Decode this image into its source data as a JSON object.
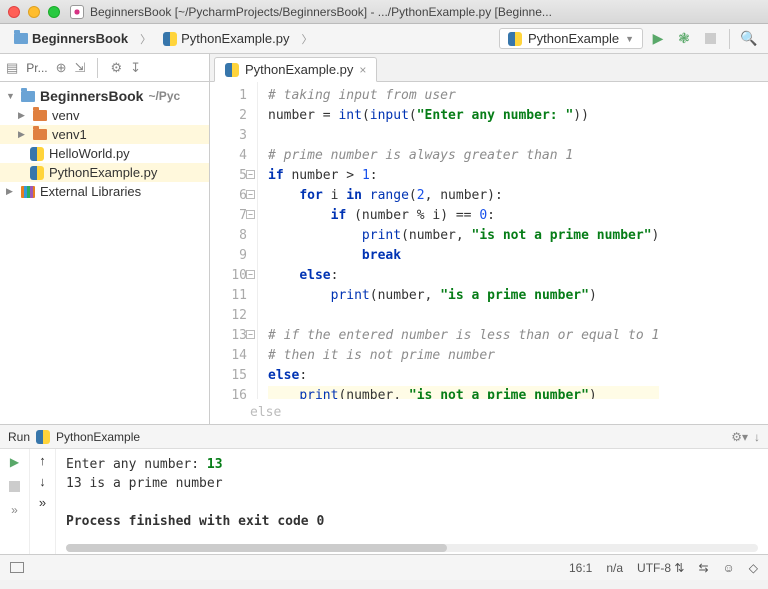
{
  "window_title": "BeginnersBook [~/PycharmProjects/BeginnersBook] - .../PythonExample.py [Beginne...",
  "breadcrumbs": {
    "project": "BeginnersBook",
    "file": "PythonExample.py"
  },
  "run_config": "PythonExample",
  "project_panel": {
    "label": "Pr...",
    "root": "BeginnersBook",
    "root_suffix": "~/Pyc",
    "items": {
      "venv": "venv",
      "venv1": "venv1",
      "hello": "HelloWorld.py",
      "example": "PythonExample.py"
    },
    "external": "External Libraries"
  },
  "tab_name": "PythonExample.py",
  "code_lines": [
    {
      "n": 1,
      "html": "<span class='c-com'># taking input from user</span>"
    },
    {
      "n": 2,
      "html": "number = <span class='c-bi'>int</span>(<span class='c-bi'>input</span>(<span class='c-str'>\"Enter any number: \"</span>))"
    },
    {
      "n": 3,
      "html": ""
    },
    {
      "n": 4,
      "html": "<span class='c-com'># prime number is always greater than 1</span>"
    },
    {
      "n": 5,
      "html": "<span class='c-kw'>if</span> number &gt; <span class='c-num'>1</span>:",
      "fold": true
    },
    {
      "n": 6,
      "html": "    <span class='c-kw'>for</span> i <span class='c-kw'>in</span> <span class='c-bi'>range</span>(<span class='c-num'>2</span>, number):",
      "fold": true
    },
    {
      "n": 7,
      "html": "        <span class='c-kw'>if</span> (number % i) == <span class='c-num'>0</span>:",
      "fold": true
    },
    {
      "n": 8,
      "html": "            <span class='c-bi'>print</span>(number, <span class='c-str'>\"is not a prime number\"</span>)"
    },
    {
      "n": 9,
      "html": "            <span class='c-kw'>break</span>"
    },
    {
      "n": 10,
      "html": "    <span class='c-kw'>else</span>:",
      "fold": true
    },
    {
      "n": 11,
      "html": "        <span class='c-bi'>print</span>(number, <span class='c-str'>\"is a prime number\"</span>)"
    },
    {
      "n": 12,
      "html": ""
    },
    {
      "n": 13,
      "html": "<span class='c-com'># if the entered number is less than or equal to 1</span>",
      "fold": true
    },
    {
      "n": 14,
      "html": "<span class='c-com'># then it is not prime number</span>"
    },
    {
      "n": 15,
      "html": "<span class='c-kw'>else</span>:"
    },
    {
      "n": 16,
      "html": "    <span class='c-bi'>print</span>(number, <span class='c-str'>\"is not a prime number\"</span>)",
      "hl": true
    }
  ],
  "breadcrumb_hint": "else",
  "run_tab": {
    "label": "Run",
    "name": "PythonExample"
  },
  "console": {
    "line1_prefix": "Enter any number: ",
    "line1_input": "13",
    "line2": "13 is a prime number",
    "line3": "Process finished with exit code 0"
  },
  "status": {
    "pos": "16:1",
    "insert": "n/a",
    "encoding": "UTF-8",
    "lock": "⇆",
    "face": "☺",
    "chat": "◇"
  }
}
